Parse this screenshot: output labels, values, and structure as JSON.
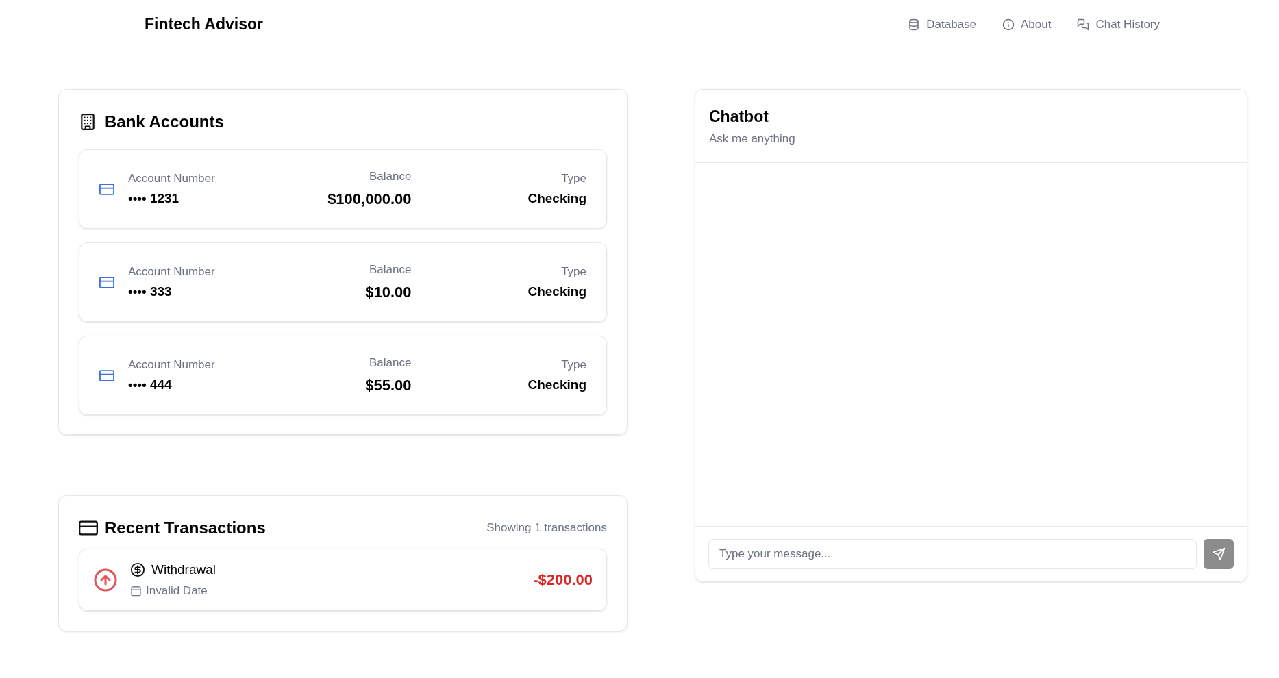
{
  "header": {
    "title": "Fintech Advisor",
    "nav": [
      {
        "kind": "database",
        "label": "Database"
      },
      {
        "kind": "info",
        "label": "About"
      },
      {
        "kind": "chat",
        "label": "Chat History"
      }
    ]
  },
  "accounts": {
    "title": "Bank Accounts",
    "items": [
      {
        "number_label": "Account Number",
        "number": "•••• 1231",
        "balance_label": "Balance",
        "balance": "$100,000.00",
        "type_label": "Type",
        "type": "Checking"
      },
      {
        "number_label": "Account Number",
        "number": "•••• 333",
        "balance_label": "Balance",
        "balance": "$10.00",
        "type_label": "Type",
        "type": "Checking"
      },
      {
        "number_label": "Account Number",
        "number": "•••• 444",
        "balance_label": "Balance",
        "balance": "$55.00",
        "type_label": "Type",
        "type": "Checking"
      }
    ]
  },
  "transactions": {
    "title": "Recent Transactions",
    "count": "Showing 1 transactions",
    "items": [
      {
        "kind": "withdrawal",
        "label": "Withdrawal",
        "date": "Invalid Date",
        "amount": "-$200.00"
      }
    ]
  },
  "chatbot": {
    "title": "Chatbot",
    "subtitle": "Ask me anything",
    "input": {
      "placeholder": "Type your message..."
    },
    "send_disabled": true
  }
}
